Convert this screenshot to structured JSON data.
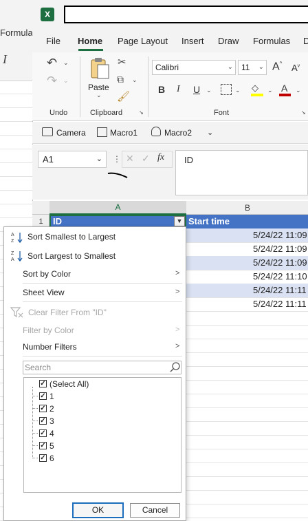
{
  "background_window": {
    "tab_label": "Formula",
    "italic_icon_label": "I"
  },
  "titlebar": {
    "app_logo": "X",
    "title": ""
  },
  "tabs": [
    {
      "label": "File"
    },
    {
      "label": "Home",
      "active": true
    },
    {
      "label": "Page Layout"
    },
    {
      "label": "Insert"
    },
    {
      "label": "Draw"
    },
    {
      "label": "Formulas"
    },
    {
      "label": "D"
    }
  ],
  "ribbon": {
    "undo_group_label": "Undo",
    "clipboard_group_label": "Clipboard",
    "font_group_label": "Font",
    "paste_label": "Paste",
    "font_name": "Calibri",
    "font_size": "11",
    "grow_font": "A",
    "shrink_font": "A",
    "bold": "B",
    "italic": "I",
    "underline": "U",
    "font_color_letter": "A"
  },
  "quick_access": {
    "camera": "Camera",
    "macro1": "Macro1",
    "macro2": "Macro2"
  },
  "formula_bar": {
    "name_box": "A1",
    "cancel_symbol": "✕",
    "enter_symbol": "✓",
    "fx": "fx",
    "value": "ID"
  },
  "grid": {
    "col_a": "A",
    "col_b": "B",
    "row_1": "1",
    "header_a": "ID",
    "header_b": "Start time",
    "start_times": [
      "5/24/22 11:09",
      "5/24/22 11:09",
      "5/24/22 11:09",
      "5/24/22 11:10",
      "5/24/22 11:11",
      "5/24/22 11:11"
    ]
  },
  "filter_menu": {
    "sort_smallest": "Sort Smallest to Largest",
    "sort_largest": "Sort Largest to Smallest",
    "sort_by_color": "Sort by Color",
    "sheet_view": "Sheet View",
    "clear_filter": "Clear Filter From \"ID\"",
    "filter_by_color": "Filter by Color",
    "number_filters": "Number Filters",
    "search_placeholder": "Search",
    "select_all": "(Select All)",
    "values": [
      "1",
      "2",
      "3",
      "4",
      "5",
      "6"
    ],
    "ok": "OK",
    "cancel": "Cancel"
  },
  "colors": {
    "excel_green": "#1d6f42",
    "table_header_blue": "#4472c4",
    "band_blue": "#d9e1f2",
    "font_color_red": "#c00000",
    "highlight_yellow": "#ffff00"
  }
}
